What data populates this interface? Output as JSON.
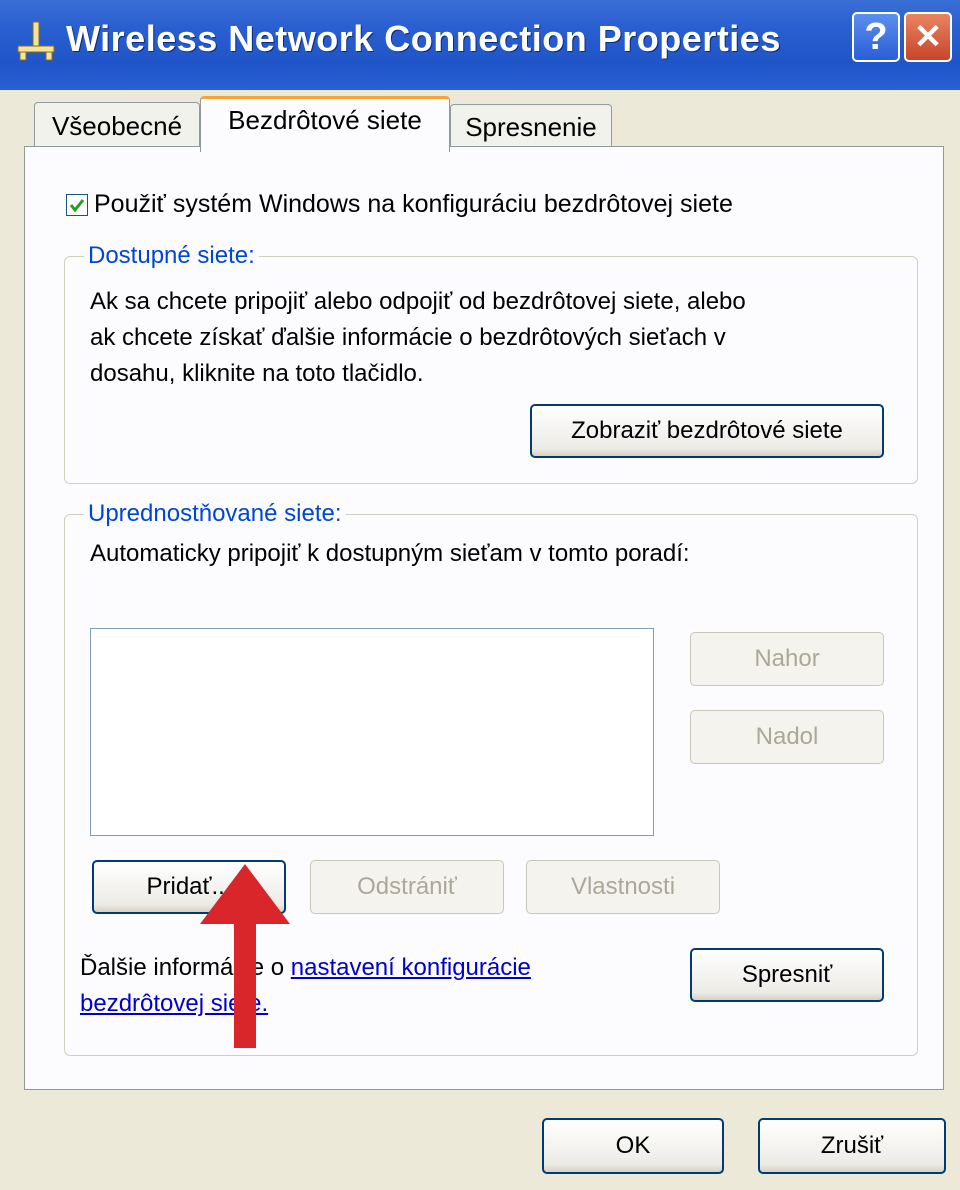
{
  "window": {
    "title": "Wireless Network Connection Properties",
    "help_label": "?",
    "close_label": "✕"
  },
  "tabs": [
    {
      "label": "Všeobecné",
      "active": false
    },
    {
      "label": "Bezdrôtové siete",
      "active": true
    },
    {
      "label": "Spresnenie",
      "active": false
    }
  ],
  "use_windows_checkbox": {
    "label": "Použiť systém Windows na konfiguráciu bezdrôtovej siete",
    "checked": true
  },
  "available_networks": {
    "legend": "Dostupné siete:",
    "description_lines": [
      "Ak sa chcete pripojiť alebo odpojiť od bezdrôtovej siete, alebo",
      "ak chcete získať ďalšie informácie o bezdrôtových sieťach v",
      "dosahu, kliknite na toto tlačidlo."
    ],
    "view_button": "Zobraziť bezdrôtové siete"
  },
  "preferred_networks": {
    "legend": "Uprednostňované siete:",
    "description": "Automaticky pripojiť k dostupným sieťam v tomto poradí:",
    "items": [],
    "up_button": "Nahor",
    "down_button": "Nadol",
    "add_button": "Pridať...",
    "remove_button": "Odstrániť",
    "properties_button": "Vlastnosti",
    "info_prefix": "Ďalšie informácie o ",
    "info_link_line1": "nastavení konfigurácie",
    "info_link_line2": "bezdrôtovej siete.",
    "advanced_button": "Spresniť"
  },
  "footer": {
    "ok_button": "OK",
    "cancel_button": "Zrušiť"
  },
  "colors": {
    "titlebar": "#2a5fd0",
    "legend": "#0046d5",
    "link": "#0000cc",
    "checkmark": "#21a121",
    "annotation_arrow": "#d9262a"
  },
  "icons": {
    "title": "network-connection-icon",
    "help": "help-icon",
    "close": "close-icon",
    "check": "checkmark-icon",
    "annotation": "red-arrow-annotation"
  }
}
